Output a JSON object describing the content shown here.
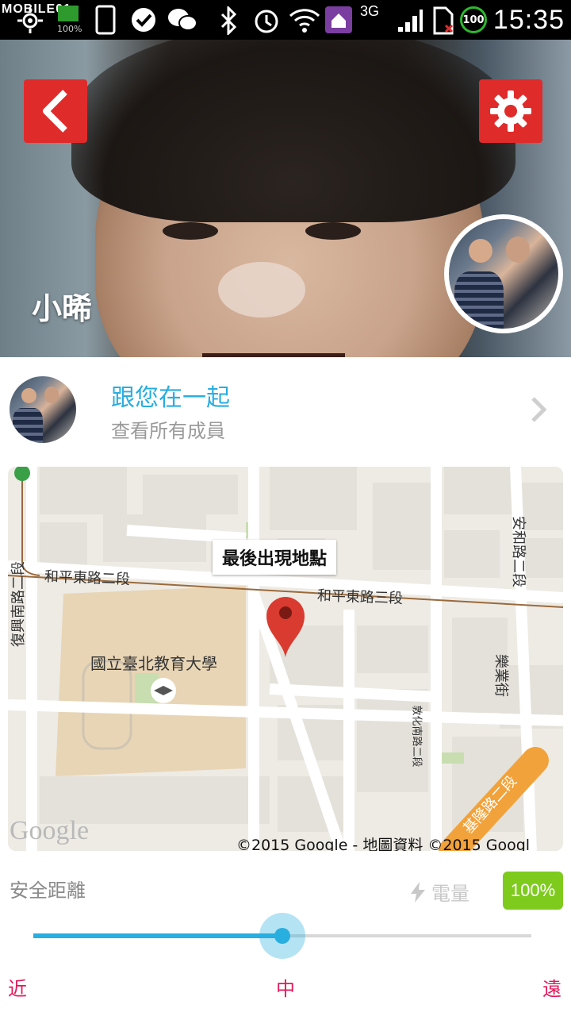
{
  "status_bar": {
    "brand": "MOBILE01",
    "battery_small": "100%",
    "network": "3G",
    "battery_ring": "100",
    "time": "15:35"
  },
  "hero": {
    "child_name": "小晞"
  },
  "group": {
    "title": "跟您在一起",
    "subtitle": "查看所有成員"
  },
  "map": {
    "callout": "最後出現地點",
    "labels": {
      "road_heping_2": "和平東路二段",
      "road_heping_3": "和平東路三段",
      "road_fuxing_s2": "復興南路二段",
      "road_anhe_2": "安和路二段",
      "road_leye": "樂業街",
      "road_dunhua_s2": "敦化南路二段",
      "road_keelung_2": "基隆路二段",
      "university": "國立臺北教育大學"
    },
    "google": "Google",
    "copyright": "©2015 Google - 地圖資料 ©2015 Googl"
  },
  "safety": {
    "label": "安全距離",
    "battery_label": "電量",
    "battery_value": "100%",
    "slider_value": 0.5,
    "min_label": "近",
    "mid_label": "中",
    "max_label": "遠"
  },
  "colors": {
    "accent": "#29aee0",
    "danger": "#e02b2b",
    "tick": "#e2185a",
    "battery": "#7ecb1e"
  }
}
